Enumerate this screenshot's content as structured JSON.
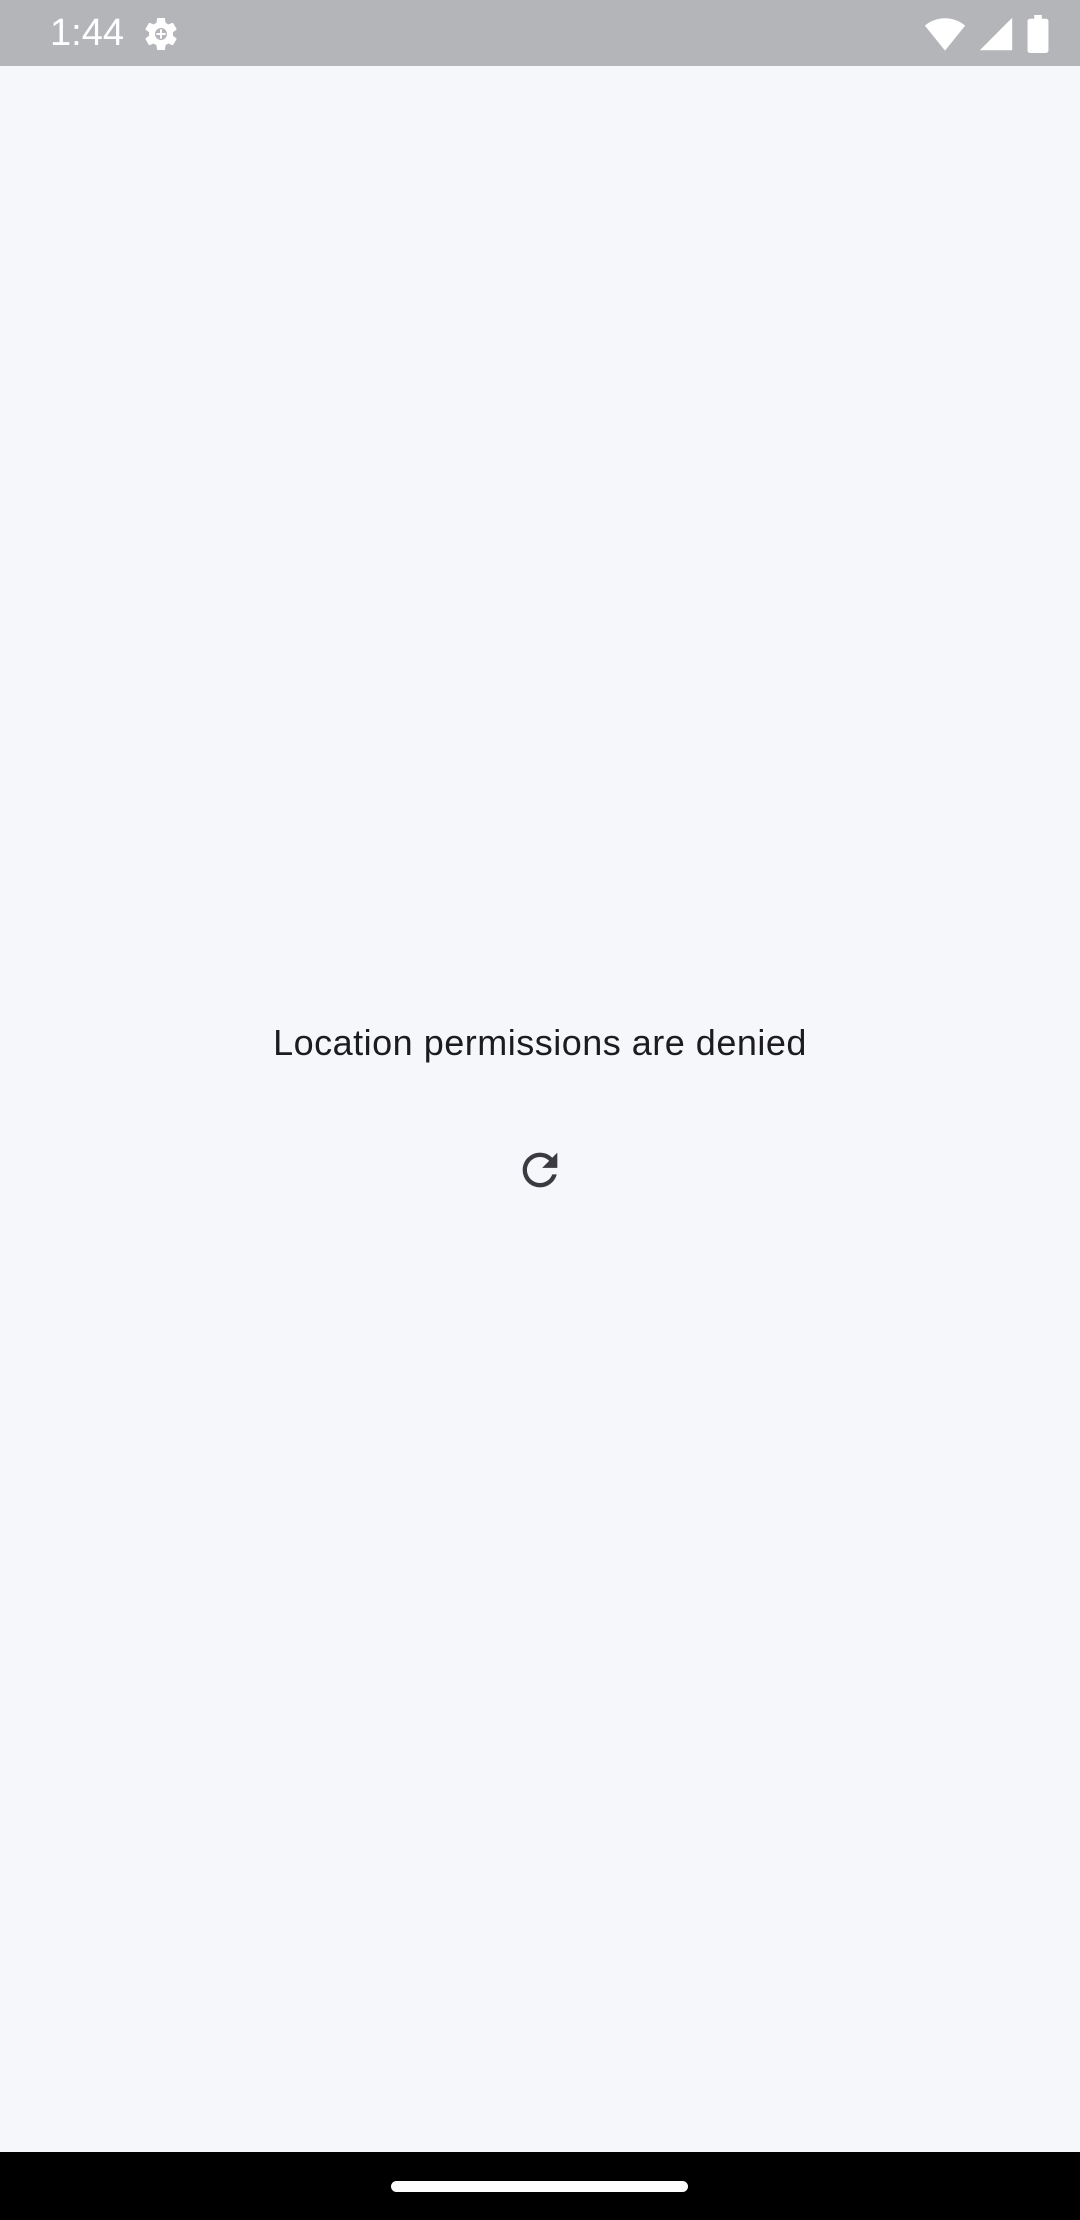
{
  "status_bar": {
    "time": "1:44",
    "left_icons": [
      "settings-gear-icon"
    ],
    "right_icons": [
      "wifi-icon",
      "cellular-signal-icon",
      "battery-icon"
    ],
    "background_color": "#b4b5b9"
  },
  "main": {
    "message": "Location permissions are denied",
    "refresh_icon": "refresh-icon",
    "background_color": "#f6f7fb",
    "text_color": "#1c1b1f"
  },
  "nav_bar": {
    "handle": "gesture-handle",
    "background_color": "#000000"
  }
}
